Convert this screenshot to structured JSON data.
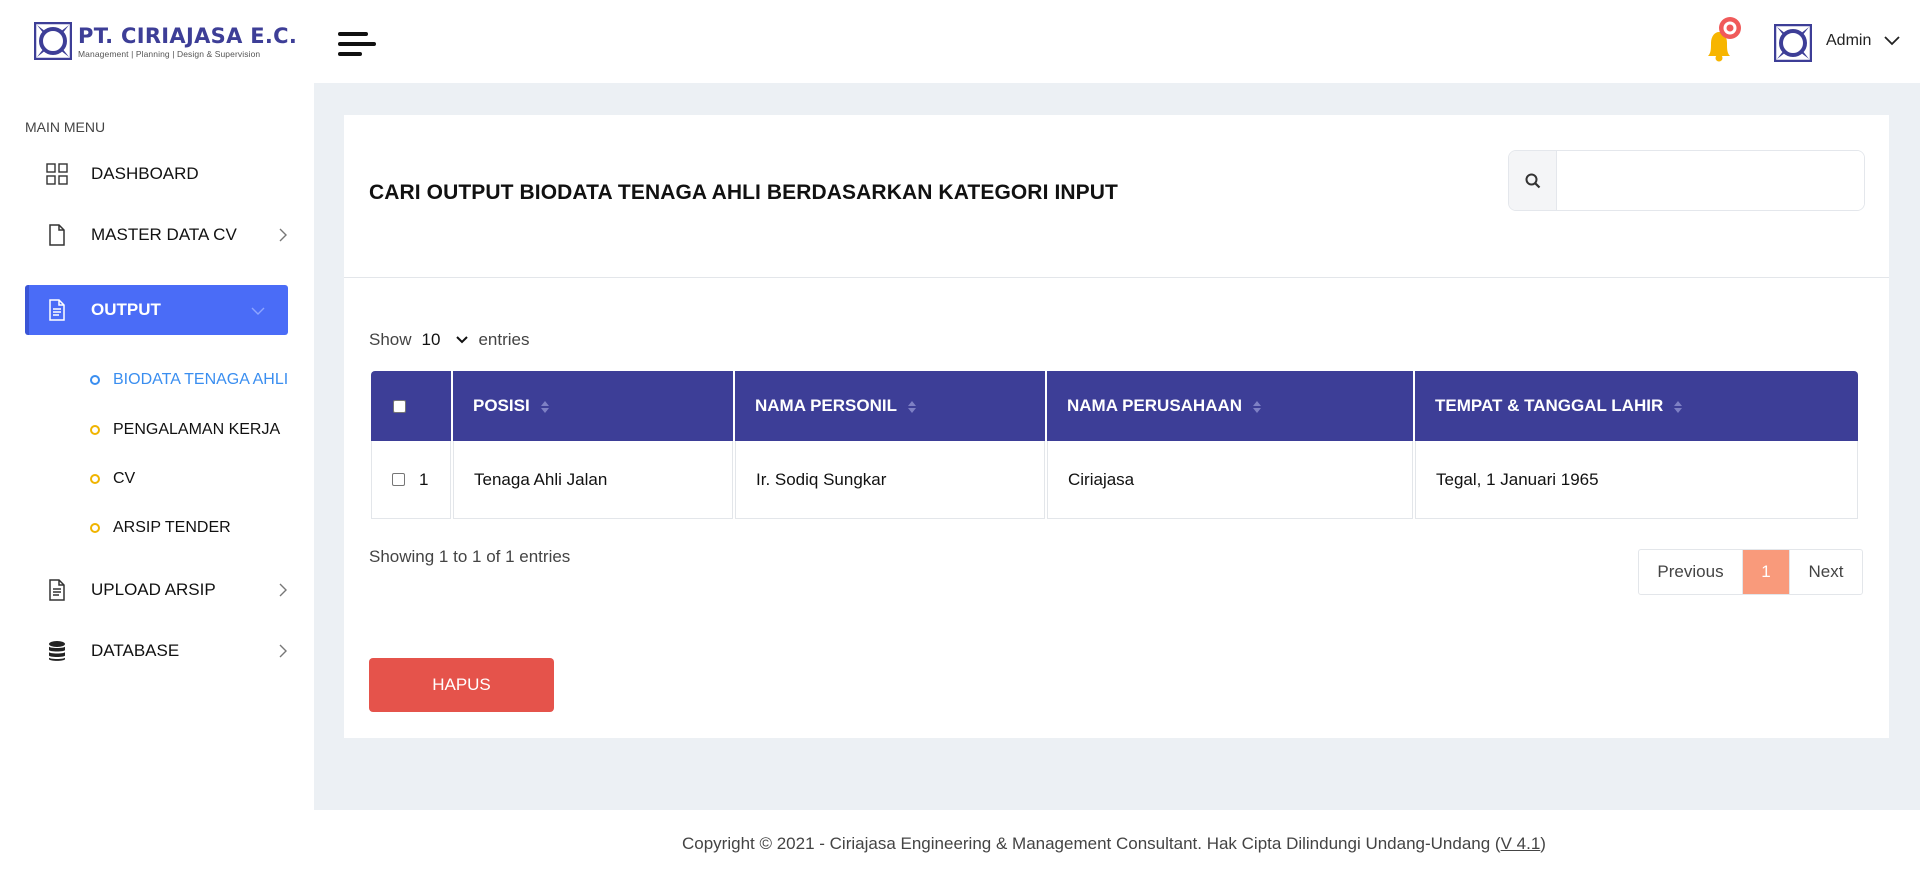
{
  "brand": {
    "name": "PT. CIRIAJASA E.C.",
    "tagline": "Management | Planning | Design & Supervision",
    "color": "#3d3e97"
  },
  "header": {
    "user_name": "Admin",
    "notification_icon": "bell-icon"
  },
  "sidebar": {
    "caption": "MAIN MENU",
    "items": [
      {
        "label": "DASHBOARD",
        "icon": "grid-icon"
      },
      {
        "label": "MASTER DATA CV",
        "icon": "file-icon"
      },
      {
        "label": "OUTPUT",
        "icon": "document-icon",
        "active": true
      },
      {
        "label": "UPLOAD ARSIP",
        "icon": "document-icon"
      },
      {
        "label": "DATABASE",
        "icon": "database-icon"
      }
    ],
    "output_submenu": [
      {
        "label": "BIODATA TENAGA AHLI",
        "current": true
      },
      {
        "label": "PENGALAMAN KERJA"
      },
      {
        "label": "CV"
      },
      {
        "label": "ARSIP TENDER"
      }
    ]
  },
  "main": {
    "title": "CARI OUTPUT BIODATA TENAGA AHLI BERDASARKAN KATEGORI INPUT",
    "search": {
      "placeholder": "",
      "value": ""
    },
    "show_label": "Show",
    "page_size": "10",
    "entries_label": "entries",
    "columns": [
      "POSISI",
      "NAMA PERSONIL",
      "NAMA PERUSAHAAN",
      "TEMPAT & TANGGAL LAHIR"
    ],
    "rows": [
      {
        "no": "1",
        "posisi": "Tenaga Ahli Jalan",
        "nama_personil": "Ir. Sodiq Sungkar",
        "nama_perusahaan": "Ciriajasa",
        "ttl": "Tegal, 1 Januari 1965"
      }
    ],
    "info": "Showing 1 to 1 of 1 entries",
    "pagination": {
      "previous": "Previous",
      "current": "1",
      "next": "Next"
    },
    "delete_label": "HAPUS"
  },
  "footer": {
    "text": "Copyright © 2021 - Ciriajasa Engineering & Management Consultant. Hak Cipta Dilindungi Undang-Undang (",
    "version": "V 4.1",
    "close": ")"
  },
  "colors": {
    "accent": "#4a6cf7",
    "table_header": "#3d3e97",
    "danger": "#e5534b",
    "page_active": "#f99a7b",
    "submenu_dot": "#f0b400"
  }
}
